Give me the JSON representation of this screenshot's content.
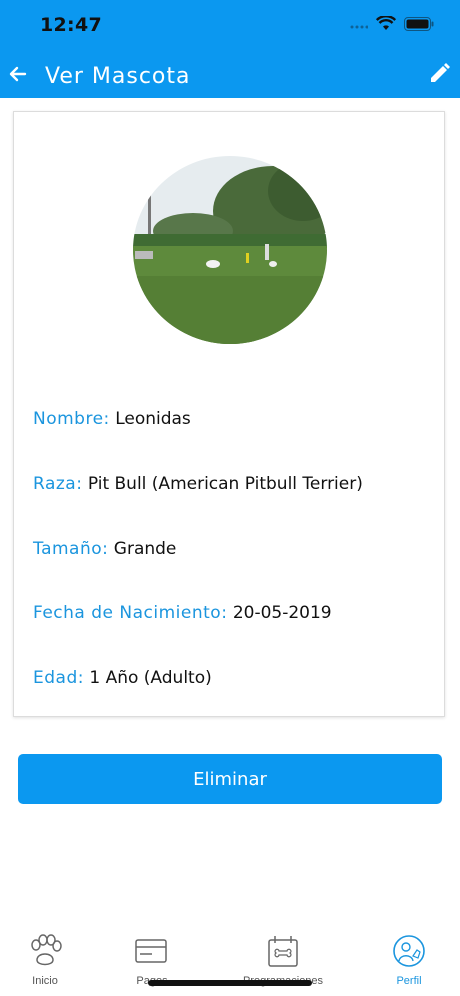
{
  "status_bar": {
    "time": "12:47"
  },
  "header": {
    "title": "Ver Mascota"
  },
  "pet": {
    "fields": [
      {
        "label": "Nombre:",
        "value": "Leonidas"
      },
      {
        "label": "Raza:",
        "value": "Pit Bull (American Pitbull Terrier)"
      },
      {
        "label": "Tamaño:",
        "value": "Grande"
      },
      {
        "label": "Fecha de Nacimiento:",
        "value": "20-05-2019"
      },
      {
        "label": "Edad:",
        "value": "1 Año (Adulto)"
      }
    ]
  },
  "actions": {
    "delete_label": "Eliminar"
  },
  "tabbar": {
    "tabs": [
      {
        "label": "Inicio",
        "icon": "paw-icon"
      },
      {
        "label": "Pagos",
        "icon": "card-icon"
      },
      {
        "label": "Programaciones",
        "icon": "calendar-bone-icon"
      },
      {
        "label": "Perfil",
        "icon": "profile-icon"
      }
    ]
  },
  "colors": {
    "primary": "#0b98f0",
    "label": "#1b95de"
  }
}
